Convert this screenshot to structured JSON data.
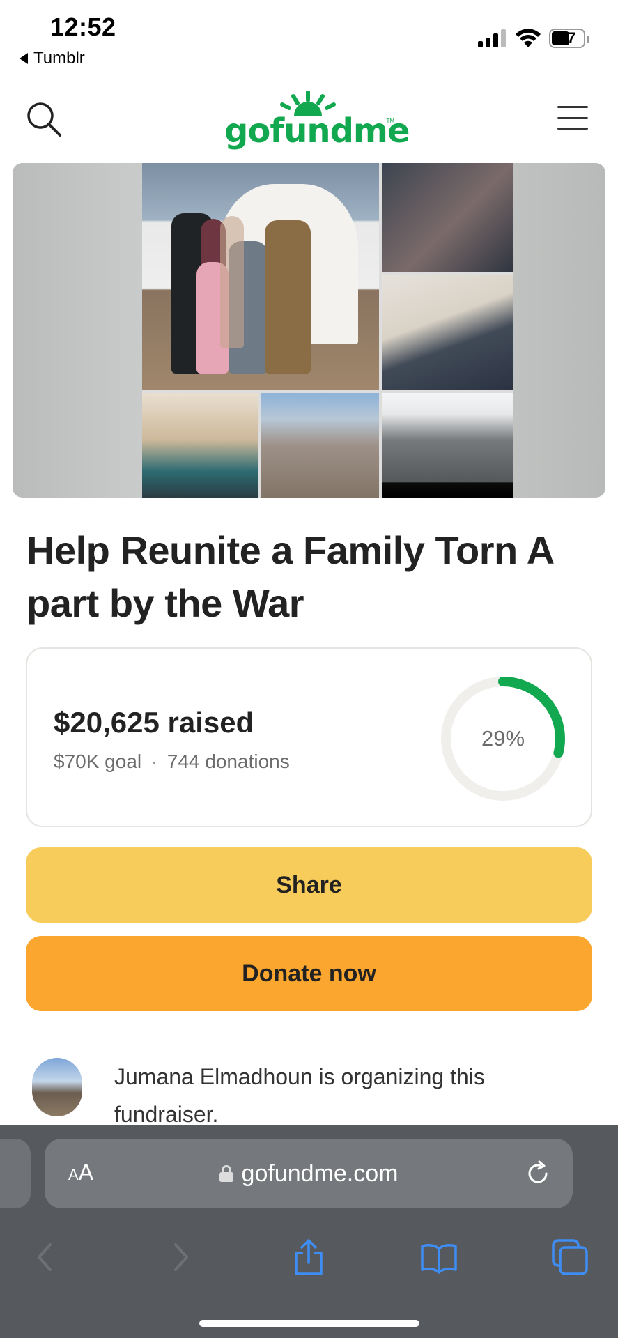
{
  "status_bar": {
    "time": "12:52",
    "back_app": "Tumblr",
    "battery_level": "57"
  },
  "header": {
    "logo_text": "gofundme",
    "logo_tm": "TM",
    "search_icon": "search-icon",
    "menu_icon": "hamburger-menu-icon",
    "brand_color": "#12a84f"
  },
  "campaign": {
    "title": "Help Reunite a Family Torn A part by the War",
    "raised": "$20,625 raised",
    "goal": "$70K goal",
    "separator": "·",
    "donations": "744 donations",
    "progress_label": "29%",
    "progress_fraction": 0.29,
    "progress_color": "#12a84f",
    "track_color": "#f0efeb"
  },
  "buttons": {
    "share": "Share",
    "donate": "Donate now",
    "share_color": "#f7cc5a",
    "donate_color": "#fba62f"
  },
  "organizer": {
    "text": "Jumana Elmadhoun is organizing this fundraiser."
  },
  "browser": {
    "text_size_label_small": "A",
    "text_size_label_large": "A",
    "url": "gofundme.com",
    "icons": [
      "back-icon",
      "forward-icon",
      "share-icon",
      "bookmarks-icon",
      "tabs-icon",
      "reload-icon",
      "lock-icon"
    ]
  }
}
